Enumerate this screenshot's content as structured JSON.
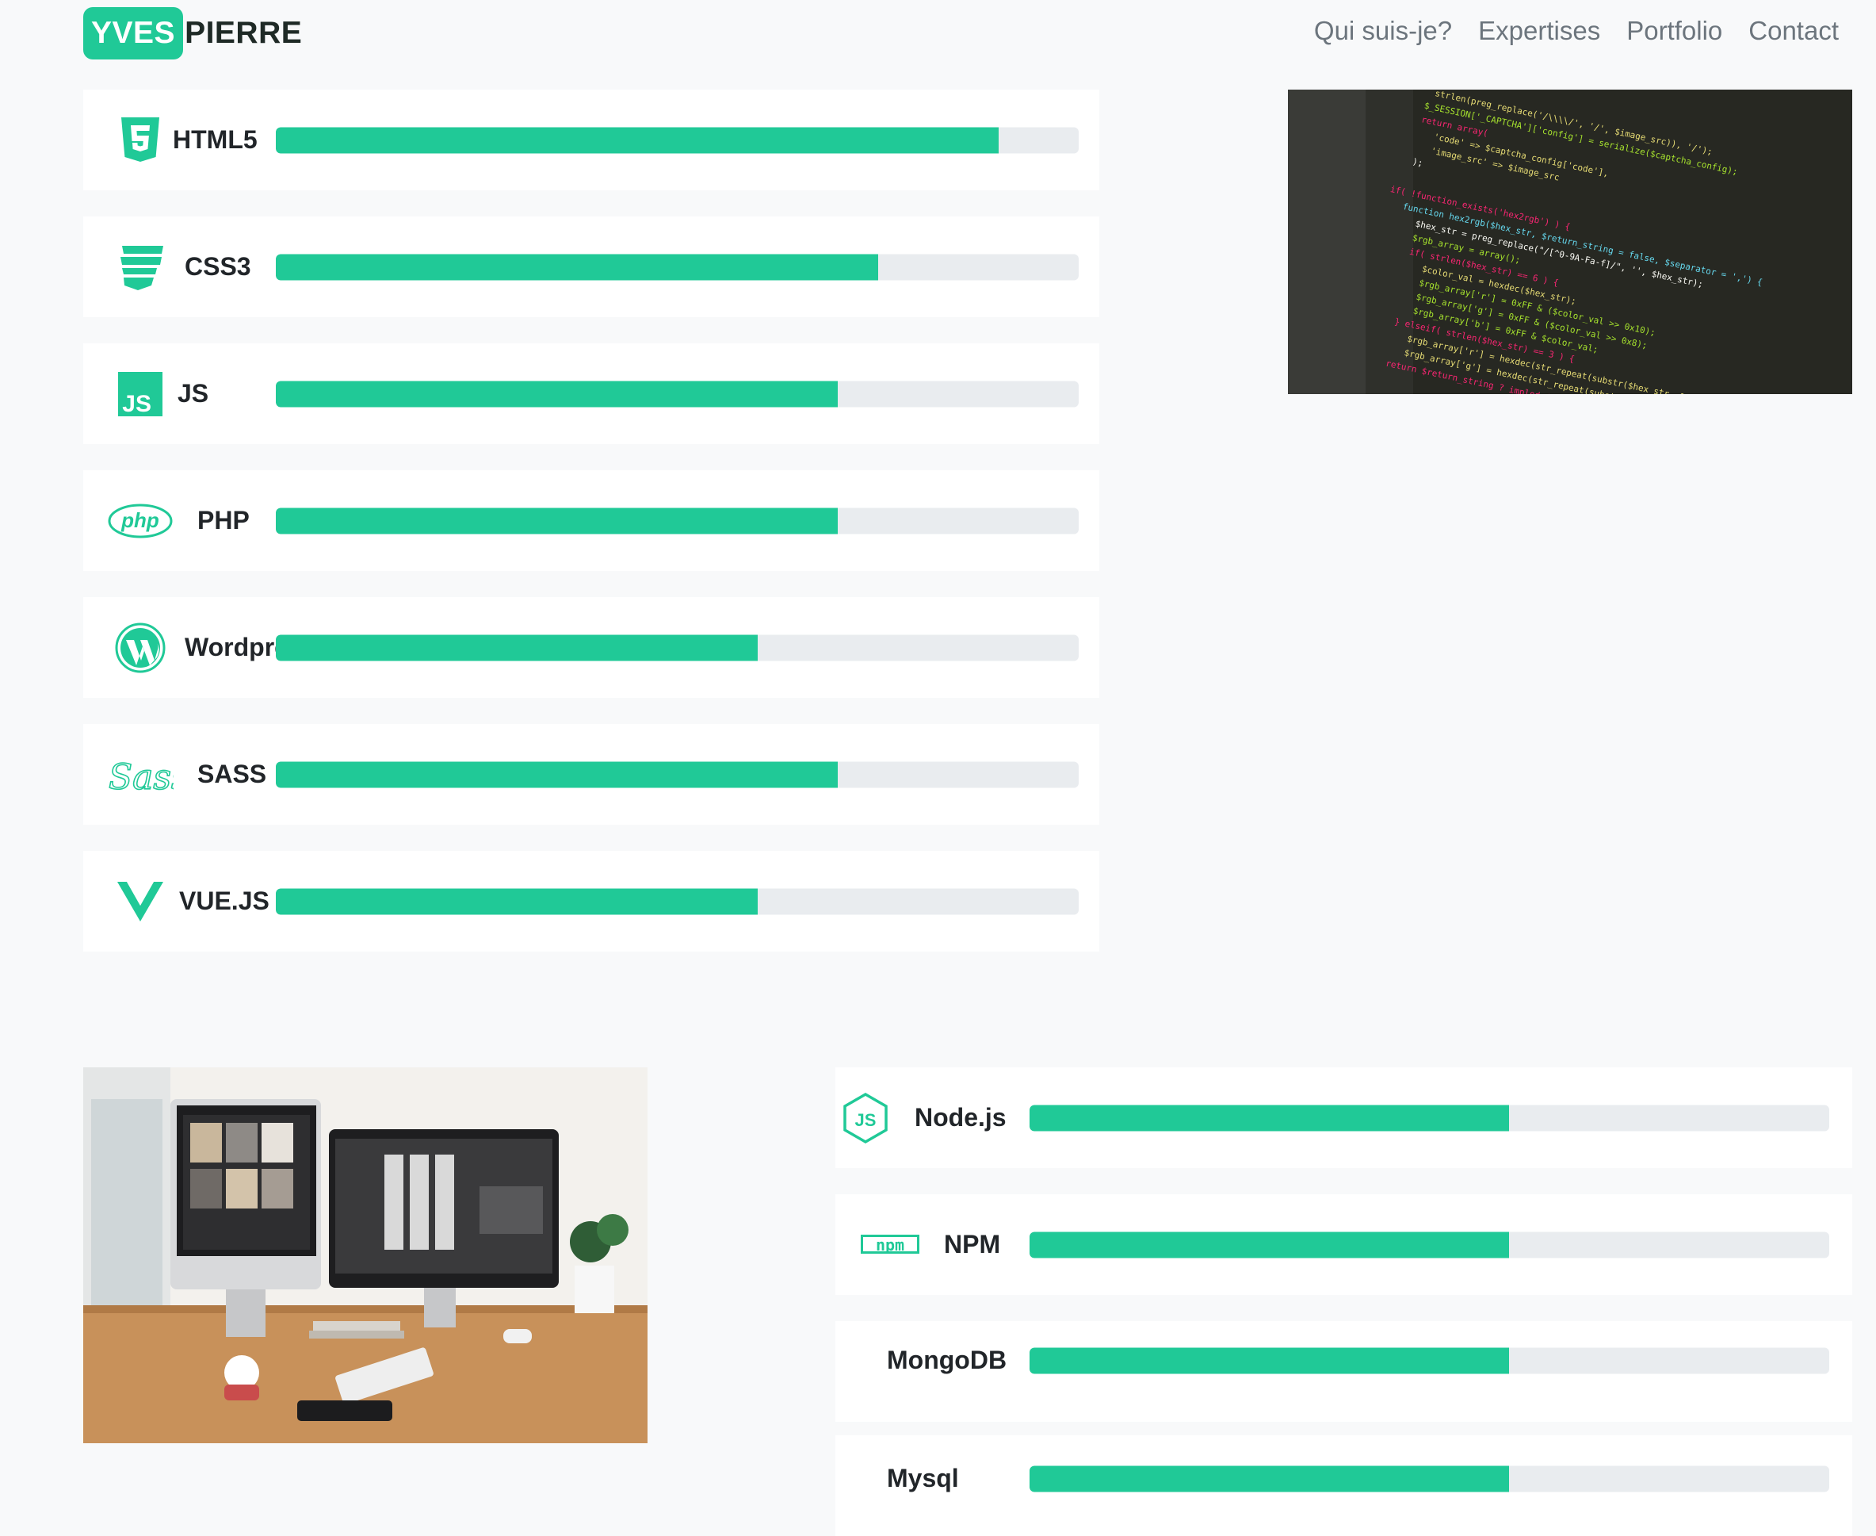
{
  "header": {
    "logo_first": "YVES",
    "logo_last": "PIERRE",
    "nav": [
      "Qui suis-je?",
      "Expertises",
      "Portfolio",
      "Contact"
    ]
  },
  "colors": {
    "accent": "#20c997",
    "track": "#e9ecef",
    "card": "#ffffff",
    "page": "#f8f9fa"
  },
  "skills_primary": [
    {
      "name": "HTML5",
      "icon": "html5-icon",
      "level": 0.9
    },
    {
      "name": "CSS3",
      "icon": "css3-icon",
      "level": 0.75
    },
    {
      "name": "JS",
      "icon": "js-icon",
      "level": 0.7
    },
    {
      "name": "PHP",
      "icon": "php-icon",
      "level": 0.7
    },
    {
      "name": "Wordpress",
      "icon": "wordpress-icon",
      "level": 0.6
    },
    {
      "name": "SASS",
      "icon": "sass-icon",
      "level": 0.7
    },
    {
      "name": "VUE.JS",
      "icon": "vuejs-icon",
      "level": 0.6
    }
  ],
  "skills_secondary": [
    {
      "name": "Node.js",
      "icon": "nodejs-icon",
      "level": 0.6
    },
    {
      "name": "NPM",
      "icon": "npm-icon",
      "level": 0.6
    },
    {
      "name": "MongoDB",
      "icon": "",
      "level": 0.6
    },
    {
      "name": "Mysql",
      "icon": "",
      "level": 0.6
    }
  ],
  "images": {
    "code": "code-editor-photo",
    "desk": "desk-computers-photo"
  }
}
